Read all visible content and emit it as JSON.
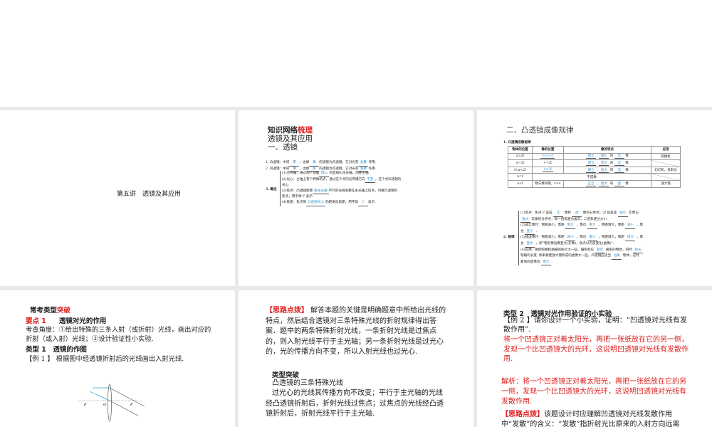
{
  "slide1": {
    "title": "第五讲　透镜及其应用"
  },
  "slide2": {
    "heading_a": "知识网络",
    "heading_b": "梳理",
    "sub1": "透镜及其应用",
    "sub2": "一、透镜",
    "lines": [
      {
        "pre": "1. 凸透镜：中间",
        "a": "厚",
        "mid": "，边缘",
        "b": "薄",
        "mid2": "的透镜为凸透镜，它对光有",
        "c": "会聚",
        "post": "作用."
      },
      {
        "pre": "2. 凹透镜：中间",
        "a": "薄",
        "mid": "，边缘",
        "b": "厚",
        "mid2": "的透镜为凹透镜，它对光有",
        "c": "发散",
        "post": "作用."
      }
    ],
    "concept_label": "3. 概念",
    "concepts": [
      {
        "pre": "(1)主光轴：通过两个球面",
        "a": "球心",
        "post": "的直线叫主光轴，简称主轴."
      },
      {
        "pre": "(2)光心：主轴上有个特殊的点，通过这个点的光传播方向",
        "a": "不变",
        "post": "，这个点叫透镜的"
      },
      {
        "pre": "光心.",
        "a": "",
        "post": ""
      },
      {
        "pre": "(3)焦点：凸透镜能使",
        "a": "跟主光轴",
        "post": "平行的光线会聚在主光轴上的点，叫做凸透镜的"
      },
      {
        "pre": "焦点，用字母 F 表示.",
        "a": "",
        "post": ""
      },
      {
        "pre": "(4)焦距：焦点到",
        "a": "凸透镜光心",
        "post": "的距离叫焦距，用字母",
        "b": "f",
        "post2": "表示."
      }
    ]
  },
  "slide3": {
    "heading": "二、凸透镜成像规律",
    "table_title": "1. 凸透镜成像规律",
    "headers": [
      "物体的位置",
      "像的位置",
      "像的特点",
      "应用"
    ],
    "rows": [
      {
        "obj": "u>2f",
        "img": "f<v<2f",
        "img_blank": true,
        "f1": "倒立",
        "f2": "缩小",
        "f3": "实",
        "app": "照相机"
      },
      {
        "obj": "u=2f",
        "img": "v=2f",
        "img_blank": false,
        "f1": "倒立",
        "f2": "等大",
        "f3": "实",
        "app": ""
      },
      {
        "obj": "f<u<2f",
        "img": "v>2f",
        "img_blank": true,
        "f1": "倒立",
        "f2": "放大",
        "f3": "实",
        "app": "幻灯机，投影仪"
      },
      {
        "obj": "u=f",
        "img": "不成像",
        "span": true,
        "app": ""
      },
      {
        "obj": "u<f",
        "img": "物与像同侧，v>u",
        "img_blank": false,
        "f1": "正立",
        "f2": "放大",
        "f3": "虚",
        "app": "放大镜"
      }
    ],
    "feature_de": "的",
    "feature_xiang": "像",
    "rule_label": "2. 规律",
    "rules": [
      "(1)焦点：焦点 F 是成 [实] 像和 [虚] 像的分界点；2f 处是成 [缩小] 实像与",
      "[放大] 实像的分界点，即一倍焦距分虚实，二倍焦距分大小.",
      "(2)成实像时：物距减小，像距 [增大] ，像也 [变大] ，物距增大，像距 [减小] ，像",
      "也 [变小] .",
      "(3)成虚像时：物距减小，像距 [减小] ，像也 [变小] ，物距增大，像距 [增大] ，像",
      "也 [变大] ，即“物近像远像变大(实像)，焦点以内反变化(虚像)”.",
      "(4)应用：要使照相机拍摄的照片大一些，摄影师应 [靠近] 被照的物体，同时 [拉长]",
      "暗箱的长度. 如果要使放大镜所成的虚像大一些，凸透镜应适当 [远离] 物体，这时",
      "看到的虚像会 [变大] ."
    ]
  },
  "slide4": {
    "heading_a": "常考类型",
    "heading_b": "突破",
    "point_label": "要点 1",
    "point_title": "透镜对光的作用",
    "angle": "考查角度：①给出特殊的三条入射（或折射）光线，画出对应的折射（或入射）光线；②设计验证性小实验.",
    "type_title": "类型 1　透镜的作图",
    "example": "【例 1 】 根据图中经透镜折射后的光线画出入射光线.",
    "diagram_labels": {
      "f_left": "F",
      "o": "O",
      "f_right": "F"
    }
  },
  "slide5": {
    "hint_label": "【思路点拨】",
    "hint": " 解答本题的关键是明确题意中所给出光线的特点，然后结合透镜对三条特殊光线的折射规律得出答案．题中的两条特殊折射光线，一条折射光线是过焦点的，则入射光线平行于主光轴；另一条折射光线是过光心的，光的传播方向不变，所以入射光线也过光心.",
    "type_heading": "类型突破",
    "sub": "凸透镜的三条特殊光线",
    "text": "过光心的光线其传播方向不改变；平行于主光轴的光线经凸透镜折射后，折射光线过焦点；过焦点的光线经凸透镜折射后，折射光线平行于主光轴."
  },
  "slide6": {
    "type_title": "类型 2　透镜对光作用验证的小实验",
    "example": "【例 2 】请你设计一个小实验，证明：“凹透镜对光线有发散作用”.",
    "answer": "将一个凹透镜正对着太阳光，再把一张纸放在它的另一侧，发现一个比凹透镜大的光环，这说明凹透镜对光线有发散作用.",
    "analysis": "解析：将一个凹透镜正对着太阳光，再把一张纸放在它的另一侧，发现一个比凹透镜大的光环，这说明凹透镜对光线有发散作用.",
    "hint_label": "【思路点拨】",
    "hint": "该题设计时应理解凹透镜对光线发散作用中“发散”的含义：“发散”指折射光比原来的入射方向远离"
  }
}
